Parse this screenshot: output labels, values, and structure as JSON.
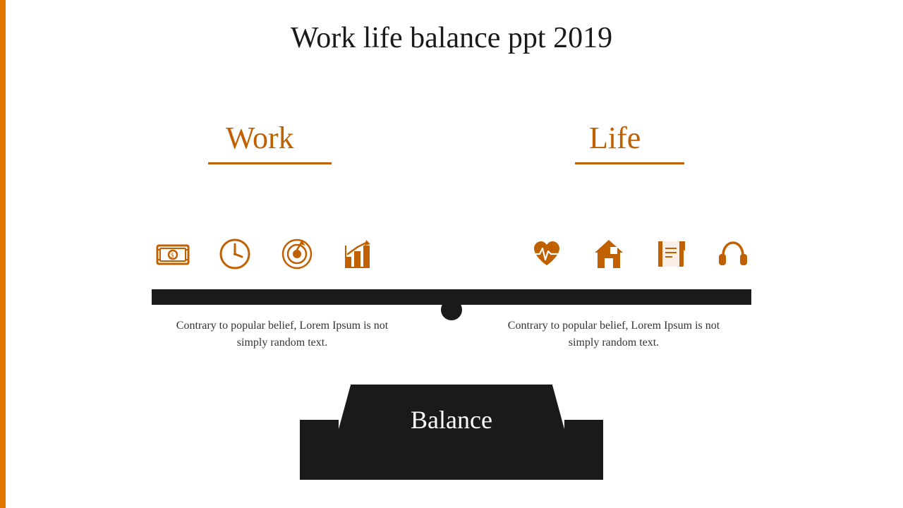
{
  "page": {
    "title": "Work life balance ppt 2019",
    "accent_color": "#c06000",
    "dark_color": "#1a1a1a"
  },
  "left_section": {
    "label": "Work",
    "text": "Contrary to popular belief, Lorem Ipsum is not simply random text."
  },
  "right_section": {
    "label": "Life",
    "text": "Contrary to popular belief, Lorem Ipsum is not simply random text."
  },
  "balance": {
    "label": "Balance"
  },
  "work_icons": [
    {
      "name": "money-icon",
      "symbol": "money"
    },
    {
      "name": "clock-icon",
      "symbol": "clock"
    },
    {
      "name": "target-icon",
      "symbol": "target"
    },
    {
      "name": "chart-icon",
      "symbol": "chart"
    }
  ],
  "life_icons": [
    {
      "name": "heart-icon",
      "symbol": "heart"
    },
    {
      "name": "home-icon",
      "symbol": "home"
    },
    {
      "name": "book-icon",
      "symbol": "book"
    },
    {
      "name": "headphones-icon",
      "symbol": "headphones"
    }
  ]
}
